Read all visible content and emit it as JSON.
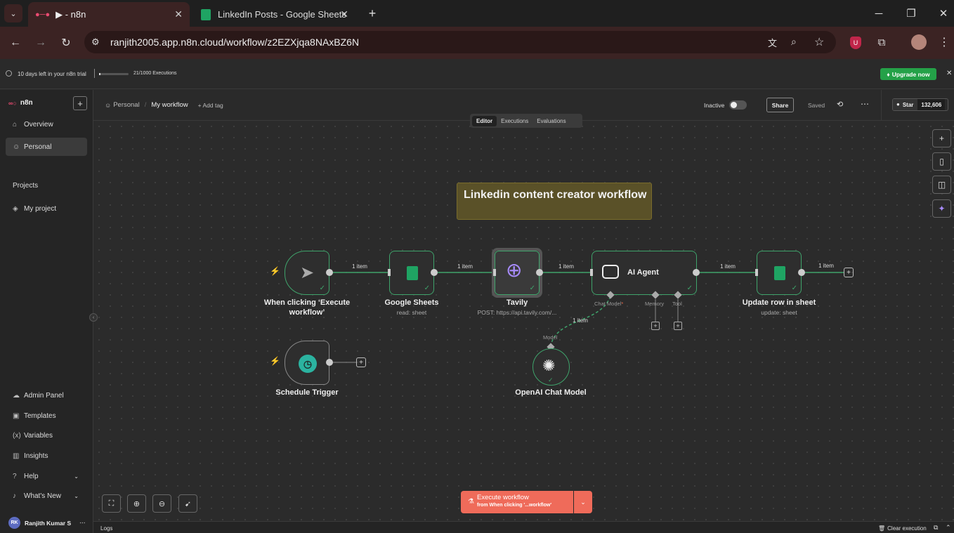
{
  "browser": {
    "tabs": [
      {
        "title": "▶ - n8n"
      },
      {
        "title": "LinkedIn Posts - Google Sheets"
      }
    ],
    "url": "ranjith2005.app.n8n.cloud/workflow/z2EZXjqa8NAxBZ6N"
  },
  "trial": {
    "text": "10 days left in your n8n trial",
    "executions": "21/1000 Executions",
    "executions_progress": 0.021,
    "upgrade": "Upgrade now"
  },
  "sidebar": {
    "logo": "n8n",
    "top_items": [
      {
        "label": "Overview",
        "icon": "home-icon"
      },
      {
        "label": "Personal",
        "icon": "user-icon"
      }
    ],
    "projects_heading": "Projects",
    "projects": [
      {
        "label": "My project",
        "icon": "layers-icon"
      }
    ],
    "bottom_items": [
      {
        "label": "Admin Panel",
        "icon": "cloud-icon"
      },
      {
        "label": "Templates",
        "icon": "box-icon"
      },
      {
        "label": "Variables",
        "icon": "variable-icon"
      },
      {
        "label": "Insights",
        "icon": "chart-icon"
      },
      {
        "label": "Help",
        "icon": "help-icon"
      },
      {
        "label": "What's New",
        "icon": "bell-icon"
      }
    ],
    "user": {
      "initials": "RK",
      "name": "Ranjith Kumar S"
    }
  },
  "header": {
    "breadcrumb_project": "Personal",
    "workflow_name": "My workflow",
    "add_tag": "+ Add tag",
    "status": "Inactive",
    "share": "Share",
    "saved": "Saved",
    "github_star": "Star",
    "github_count": "132,606",
    "tabs": [
      "Editor",
      "Executions",
      "Evaluations"
    ]
  },
  "canvas": {
    "sticky_note": "Linkedin content creator workflow",
    "nodes": {
      "manual_trigger": {
        "label_line1": "When clicking ‘Execute",
        "label_line2": "workflow’"
      },
      "google_sheets": {
        "label": "Google Sheets",
        "sub": "read: sheet"
      },
      "tavily": {
        "label": "Tavily",
        "sub": "POST: https://api.tavily.com/..."
      },
      "ai_agent": {
        "label": "AI Agent",
        "ports": [
          "Chat Model",
          "Memory",
          "Tool"
        ],
        "required_marker": "*"
      },
      "update_row": {
        "label": "Update row in sheet",
        "sub": "update: sheet"
      },
      "schedule": {
        "label": "Schedule Trigger"
      },
      "openai": {
        "label": "OpenAI Chat Model",
        "port": "Model"
      }
    },
    "connection_label": "1 item"
  },
  "execute": {
    "label": "Execute workflow",
    "sub": "from When clicking '...workflow'"
  },
  "logs": {
    "label": "Logs",
    "clear": "Clear execution"
  }
}
